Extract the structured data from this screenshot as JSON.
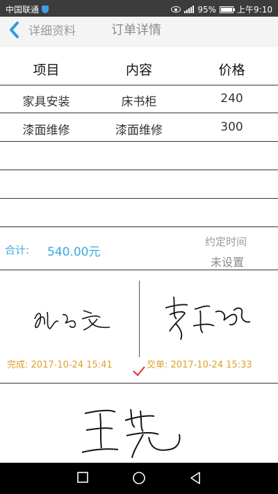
{
  "status_bar": {
    "carrier": "中国联通",
    "battery_percent": "95%",
    "time": "上午9:10",
    "icons": [
      "shield-icon",
      "eye-icon",
      "signal-icon",
      "battery-icon"
    ]
  },
  "nav": {
    "back_icon": "chevron-left-icon",
    "back_label": "详细资料",
    "title": "订单详情"
  },
  "table": {
    "headers": [
      "项目",
      "内容",
      "价格"
    ],
    "rows": [
      [
        "家具安装",
        "床书柜",
        "240"
      ],
      [
        "漆面维修",
        "漆面维修",
        "300"
      ],
      [
        "",
        "",
        ""
      ],
      [
        "",
        "",
        ""
      ],
      [
        "",
        "",
        ""
      ]
    ]
  },
  "summary": {
    "total_label": "合计:",
    "total_value": "540.00元",
    "appointment_label": "约定时间",
    "appointment_value": "未设置"
  },
  "signatures": {
    "completed_label": "完成:",
    "completed_time": "2017-10-24 15:41",
    "submitted_label": "交单:",
    "submitted_time": "2017-10-24 15:33"
  },
  "colors": {
    "accent": "#3aa8e0",
    "timestamp": "#e0a02a",
    "check": "#e03030"
  },
  "system_nav": [
    "square-icon",
    "circle-icon",
    "triangle-back-icon"
  ]
}
